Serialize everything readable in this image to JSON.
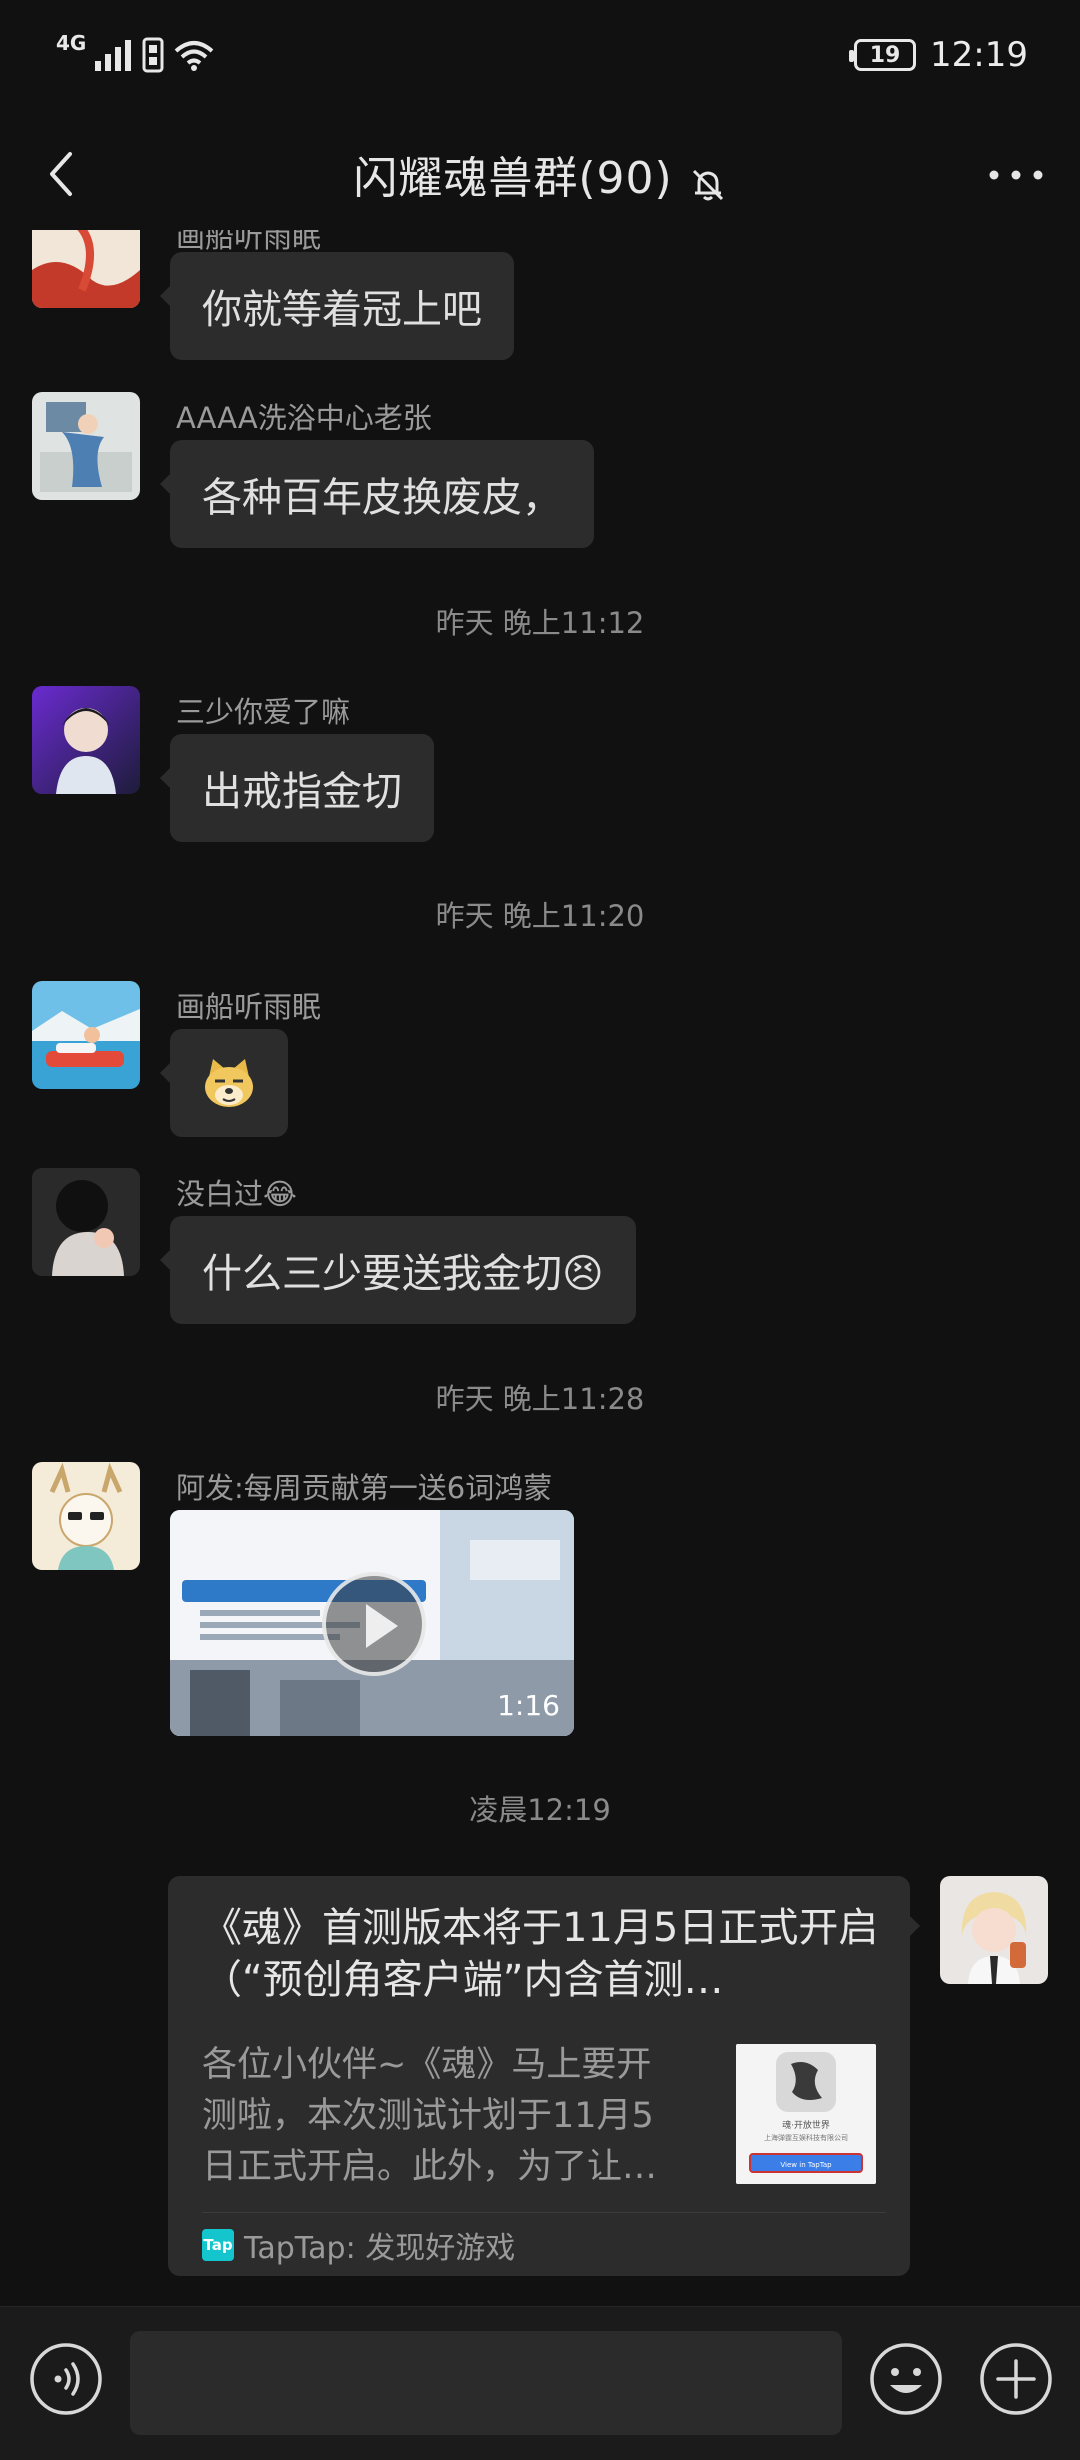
{
  "status_bar": {
    "network": "4G",
    "battery": "19",
    "clock": "12:19"
  },
  "header": {
    "title": "闪耀魂兽群(90)"
  },
  "messages": [
    {
      "type": "text",
      "sender": "画船听雨眠",
      "text": "你就等着冠上吧"
    },
    {
      "type": "text",
      "sender": "AAAA洗浴中心老张",
      "text": "各种百年皮换废皮，"
    },
    {
      "type": "time",
      "text": "昨天 晚上11:12"
    },
    {
      "type": "text",
      "sender": "三少你爱了嘛",
      "text": "出戒指金切"
    },
    {
      "type": "time",
      "text": "昨天 晚上11:20"
    },
    {
      "type": "sticker",
      "sender": "画船听雨眠",
      "icon": "doge-icon"
    },
    {
      "type": "text",
      "sender": "没白过😂",
      "text": "什么三少要送我金切😣"
    },
    {
      "type": "time",
      "text": "昨天 晚上11:28"
    },
    {
      "type": "video",
      "sender": "阿发:每周贡献第一送6词鸿蒙",
      "duration": "1:16"
    },
    {
      "type": "time",
      "text": "凌晨12:19"
    },
    {
      "type": "link_card",
      "title": "《魂》首测版本将于11月5日正式开启（“预创角客户端”内含首测…",
      "description": "各位小伙伴~《魂》马上要开测啦，本次测试计划于11月5日正式开启。此外，为了让…",
      "source": "TapTap: 发现好游戏",
      "source_logo": "Tap",
      "thumb_line1": "魂·开放世界",
      "thumb_line2": "上海弹霆互娱科技有限公司",
      "thumb_button": "View in TapTap"
    }
  ],
  "colors": {
    "background": "#111111",
    "bubble": "#2c2c2c",
    "timestamp": "#8a8a8a",
    "sender": "#9a9a9a",
    "taptap": "#15c5ce"
  }
}
